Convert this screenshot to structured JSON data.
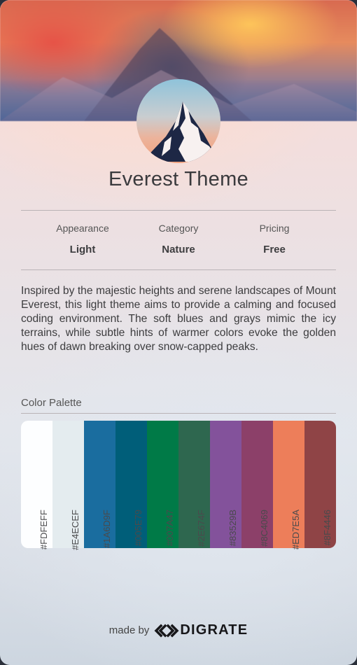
{
  "header": {
    "theme_name": "Everest Theme"
  },
  "meta": [
    {
      "label": "Appearance",
      "value": "Light"
    },
    {
      "label": "Category",
      "value": "Nature"
    },
    {
      "label": "Pricing",
      "value": "Free"
    }
  ],
  "description": "Inspired by the majestic heights and serene landscapes of Mount Everest, this light theme aims to provide a calming and focused coding environment. The soft blues and grays mimic the icy terrains, while subtle hints of warmer colors evoke the golden hues of dawn breaking over snow-capped peaks.",
  "palette": {
    "label": "Color Palette",
    "colors": [
      "#FDFEFF",
      "#E4ECEF",
      "#1A6D9F",
      "#005E79",
      "#007A47",
      "#2E674F",
      "#83529B",
      "#8C4069",
      "#ED7E5A",
      "#8F4446"
    ]
  },
  "footer": {
    "prefix": "made by",
    "brand": "DIGRATE"
  }
}
